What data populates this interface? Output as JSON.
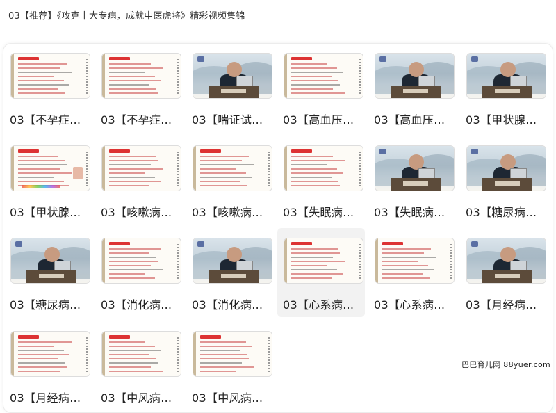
{
  "page": {
    "title": "03【推荐】《攻克十大专病，成就中医虎将》精彩视频集锦",
    "watermark": "巴巴育儿网 88yuer.com"
  },
  "items": [
    {
      "label": "03【不孕症…",
      "thumb": "slide-notes"
    },
    {
      "label": "03【不孕症…",
      "thumb": "slide-notes"
    },
    {
      "label": "03【喘证试…",
      "thumb": "lecture-video"
    },
    {
      "label": "03【高血压…",
      "thumb": "slide-notes"
    },
    {
      "label": "03【高血压…",
      "thumb": "lecture-video"
    },
    {
      "label": "03【甲状腺…",
      "thumb": "lecture-video"
    },
    {
      "label": "03【甲状腺…",
      "thumb": "slide-notes"
    },
    {
      "label": "03【咳嗽病…",
      "thumb": "slide-notes"
    },
    {
      "label": "03【咳嗽病…",
      "thumb": "slide-notes"
    },
    {
      "label": "03【失眠病…",
      "thumb": "slide-notes"
    },
    {
      "label": "03【失眠病…",
      "thumb": "lecture-video"
    },
    {
      "label": "03【糖尿病…",
      "thumb": "lecture-video"
    },
    {
      "label": "03【糖尿病…",
      "thumb": "lecture-video"
    },
    {
      "label": "03【消化病…",
      "thumb": "slide-notes"
    },
    {
      "label": "03【消化病…",
      "thumb": "lecture-video"
    },
    {
      "label": "03【心系病…",
      "thumb": "slide-notes"
    },
    {
      "label": "03【心系病…",
      "thumb": "slide-notes"
    },
    {
      "label": "03【月经病…",
      "thumb": "lecture-video"
    },
    {
      "label": "03【月经病…",
      "thumb": "slide-notes"
    },
    {
      "label": "03【中风病…",
      "thumb": "slide-notes"
    },
    {
      "label": "03【中风病…",
      "thumb": "slide-notes"
    }
  ]
}
